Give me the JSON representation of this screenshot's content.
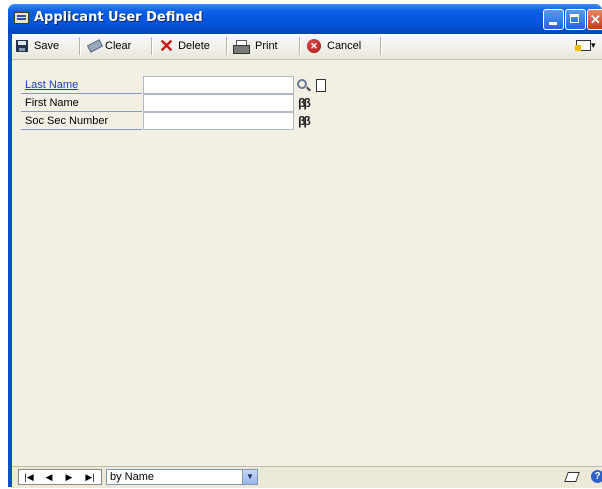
{
  "window": {
    "title": "Applicant User Defined"
  },
  "toolbar": {
    "save_label": "Save",
    "clear_label": "Clear",
    "delete_label": "Delete",
    "print_label": "Print",
    "cancel_label": "Cancel"
  },
  "form": {
    "fields": [
      {
        "label": "Last Name",
        "value": ""
      },
      {
        "label": "First Name",
        "value": ""
      },
      {
        "label": "Soc Sec Number",
        "value": ""
      }
    ]
  },
  "statusbar": {
    "sort_by": "by Name",
    "nav": [
      "|◀",
      "◀",
      "▶",
      "▶|"
    ]
  },
  "icons": [
    "save-icon",
    "clear-icon",
    "delete-icon",
    "print-icon",
    "cancel-icon",
    "lookup-icon",
    "note-icon",
    "binoculars-icon",
    "help-icon"
  ],
  "colors": {
    "titlebar": "#0a5ee8",
    "client_bg": "#f2f0e4",
    "link": "#1a3cc8"
  }
}
